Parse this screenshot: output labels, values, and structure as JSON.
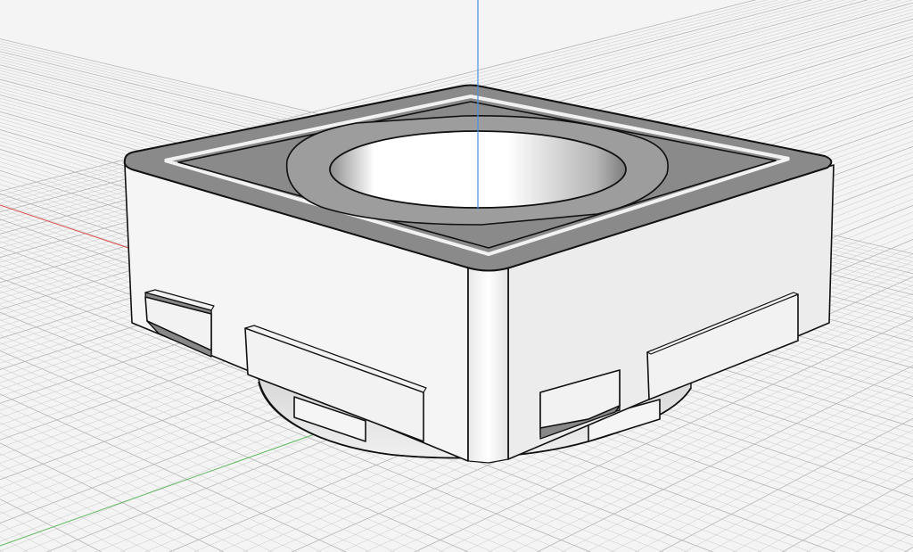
{
  "viewport": {
    "background_color": "#f4f4f4",
    "grid_color": "#c9c9c9",
    "grid_major_color": "#b4b4b4"
  },
  "axes": {
    "x_axis_color": "#d9534f",
    "y_axis_color": "#5cb85c",
    "z_axis_color": "#4a90e2"
  },
  "model": {
    "body_face_color": "#f5f5f5",
    "body_shade_color": "#ececec",
    "rim_color": "#8a8a8a",
    "inner_ring_color": "#9d9d9d",
    "bore_color": "#ffffff",
    "edge_color": "#111111",
    "tab_dark_color": "#888888",
    "tab_light_color": "#f2f2f2"
  }
}
